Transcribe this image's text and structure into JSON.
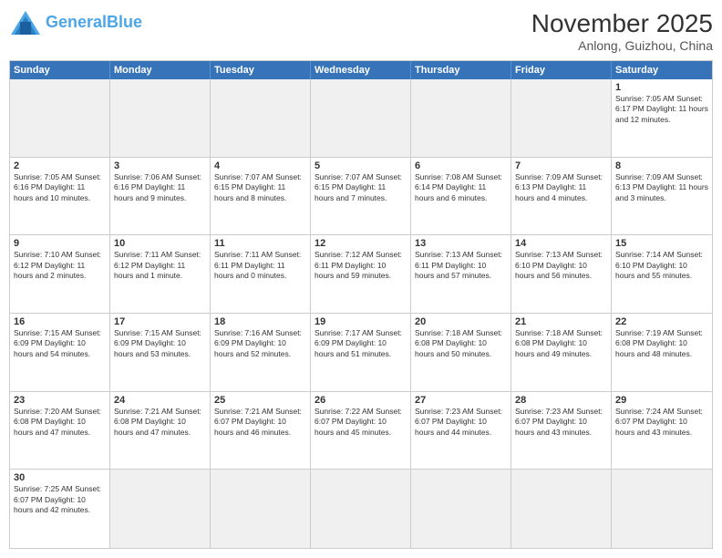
{
  "header": {
    "logo_general": "General",
    "logo_blue": "Blue",
    "month_title": "November 2025",
    "location": "Anlong, Guizhou, China"
  },
  "day_headers": [
    "Sunday",
    "Monday",
    "Tuesday",
    "Wednesday",
    "Thursday",
    "Friday",
    "Saturday"
  ],
  "weeks": [
    [
      {
        "date": "",
        "info": ""
      },
      {
        "date": "",
        "info": ""
      },
      {
        "date": "",
        "info": ""
      },
      {
        "date": "",
        "info": ""
      },
      {
        "date": "",
        "info": ""
      },
      {
        "date": "",
        "info": ""
      },
      {
        "date": "1",
        "info": "Sunrise: 7:05 AM\nSunset: 6:17 PM\nDaylight: 11 hours\nand 12 minutes."
      }
    ],
    [
      {
        "date": "2",
        "info": "Sunrise: 7:05 AM\nSunset: 6:16 PM\nDaylight: 11 hours\nand 10 minutes."
      },
      {
        "date": "3",
        "info": "Sunrise: 7:06 AM\nSunset: 6:16 PM\nDaylight: 11 hours\nand 9 minutes."
      },
      {
        "date": "4",
        "info": "Sunrise: 7:07 AM\nSunset: 6:15 PM\nDaylight: 11 hours\nand 8 minutes."
      },
      {
        "date": "5",
        "info": "Sunrise: 7:07 AM\nSunset: 6:15 PM\nDaylight: 11 hours\nand 7 minutes."
      },
      {
        "date": "6",
        "info": "Sunrise: 7:08 AM\nSunset: 6:14 PM\nDaylight: 11 hours\nand 6 minutes."
      },
      {
        "date": "7",
        "info": "Sunrise: 7:09 AM\nSunset: 6:13 PM\nDaylight: 11 hours\nand 4 minutes."
      },
      {
        "date": "8",
        "info": "Sunrise: 7:09 AM\nSunset: 6:13 PM\nDaylight: 11 hours\nand 3 minutes."
      }
    ],
    [
      {
        "date": "9",
        "info": "Sunrise: 7:10 AM\nSunset: 6:12 PM\nDaylight: 11 hours\nand 2 minutes."
      },
      {
        "date": "10",
        "info": "Sunrise: 7:11 AM\nSunset: 6:12 PM\nDaylight: 11 hours\nand 1 minute."
      },
      {
        "date": "11",
        "info": "Sunrise: 7:11 AM\nSunset: 6:11 PM\nDaylight: 11 hours\nand 0 minutes."
      },
      {
        "date": "12",
        "info": "Sunrise: 7:12 AM\nSunset: 6:11 PM\nDaylight: 10 hours\nand 59 minutes."
      },
      {
        "date": "13",
        "info": "Sunrise: 7:13 AM\nSunset: 6:11 PM\nDaylight: 10 hours\nand 57 minutes."
      },
      {
        "date": "14",
        "info": "Sunrise: 7:13 AM\nSunset: 6:10 PM\nDaylight: 10 hours\nand 56 minutes."
      },
      {
        "date": "15",
        "info": "Sunrise: 7:14 AM\nSunset: 6:10 PM\nDaylight: 10 hours\nand 55 minutes."
      }
    ],
    [
      {
        "date": "16",
        "info": "Sunrise: 7:15 AM\nSunset: 6:09 PM\nDaylight: 10 hours\nand 54 minutes."
      },
      {
        "date": "17",
        "info": "Sunrise: 7:15 AM\nSunset: 6:09 PM\nDaylight: 10 hours\nand 53 minutes."
      },
      {
        "date": "18",
        "info": "Sunrise: 7:16 AM\nSunset: 6:09 PM\nDaylight: 10 hours\nand 52 minutes."
      },
      {
        "date": "19",
        "info": "Sunrise: 7:17 AM\nSunset: 6:09 PM\nDaylight: 10 hours\nand 51 minutes."
      },
      {
        "date": "20",
        "info": "Sunrise: 7:18 AM\nSunset: 6:08 PM\nDaylight: 10 hours\nand 50 minutes."
      },
      {
        "date": "21",
        "info": "Sunrise: 7:18 AM\nSunset: 6:08 PM\nDaylight: 10 hours\nand 49 minutes."
      },
      {
        "date": "22",
        "info": "Sunrise: 7:19 AM\nSunset: 6:08 PM\nDaylight: 10 hours\nand 48 minutes."
      }
    ],
    [
      {
        "date": "23",
        "info": "Sunrise: 7:20 AM\nSunset: 6:08 PM\nDaylight: 10 hours\nand 47 minutes."
      },
      {
        "date": "24",
        "info": "Sunrise: 7:21 AM\nSunset: 6:08 PM\nDaylight: 10 hours\nand 47 minutes."
      },
      {
        "date": "25",
        "info": "Sunrise: 7:21 AM\nSunset: 6:07 PM\nDaylight: 10 hours\nand 46 minutes."
      },
      {
        "date": "26",
        "info": "Sunrise: 7:22 AM\nSunset: 6:07 PM\nDaylight: 10 hours\nand 45 minutes."
      },
      {
        "date": "27",
        "info": "Sunrise: 7:23 AM\nSunset: 6:07 PM\nDaylight: 10 hours\nand 44 minutes."
      },
      {
        "date": "28",
        "info": "Sunrise: 7:23 AM\nSunset: 6:07 PM\nDaylight: 10 hours\nand 43 minutes."
      },
      {
        "date": "29",
        "info": "Sunrise: 7:24 AM\nSunset: 6:07 PM\nDaylight: 10 hours\nand 43 minutes."
      }
    ],
    [
      {
        "date": "30",
        "info": "Sunrise: 7:25 AM\nSunset: 6:07 PM\nDaylight: 10 hours\nand 42 minutes."
      },
      {
        "date": "",
        "info": ""
      },
      {
        "date": "",
        "info": ""
      },
      {
        "date": "",
        "info": ""
      },
      {
        "date": "",
        "info": ""
      },
      {
        "date": "",
        "info": ""
      },
      {
        "date": "",
        "info": ""
      }
    ]
  ]
}
